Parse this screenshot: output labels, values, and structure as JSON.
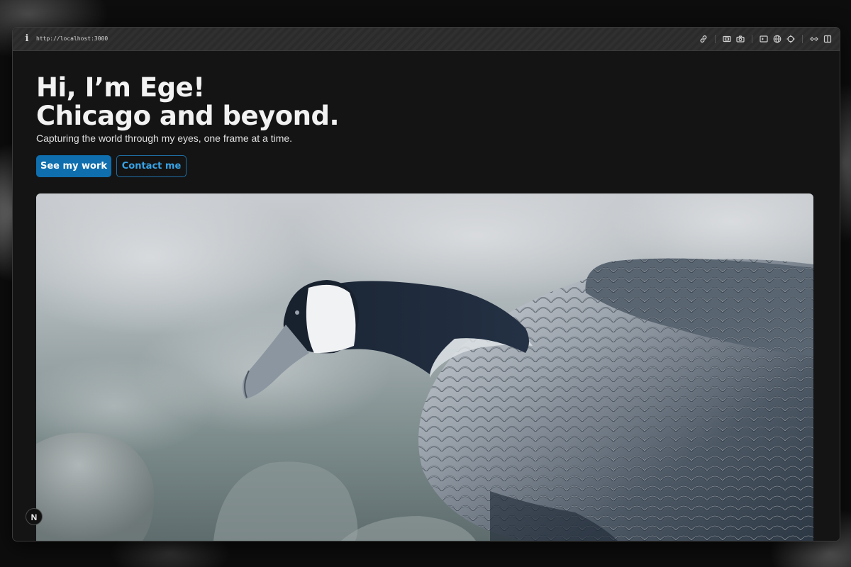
{
  "browser": {
    "url": "http://localhost:3000",
    "info_icon": "info-icon",
    "toolbar_icons": [
      "link-icon",
      "screenshot-icon",
      "camera-icon",
      "terminal-icon",
      "globe-icon",
      "crosshair-icon",
      "resize-icon",
      "sidebar-icon"
    ]
  },
  "hero": {
    "headline_line1": "Hi, I’m Ege!",
    "headline_line2": "Chicago and beyond.",
    "subtitle": "Capturing the world through my eyes, one frame at a time.",
    "primary_button": "See my work",
    "secondary_button": "Contact me"
  },
  "photo": {
    "subject": "goose-photo"
  },
  "dev_badge": {
    "label": "N"
  },
  "colors": {
    "background": "#141414",
    "primary_button": "#0f6fae",
    "secondary_button_text": "#38a3e6",
    "text": "#f2f2f2"
  }
}
